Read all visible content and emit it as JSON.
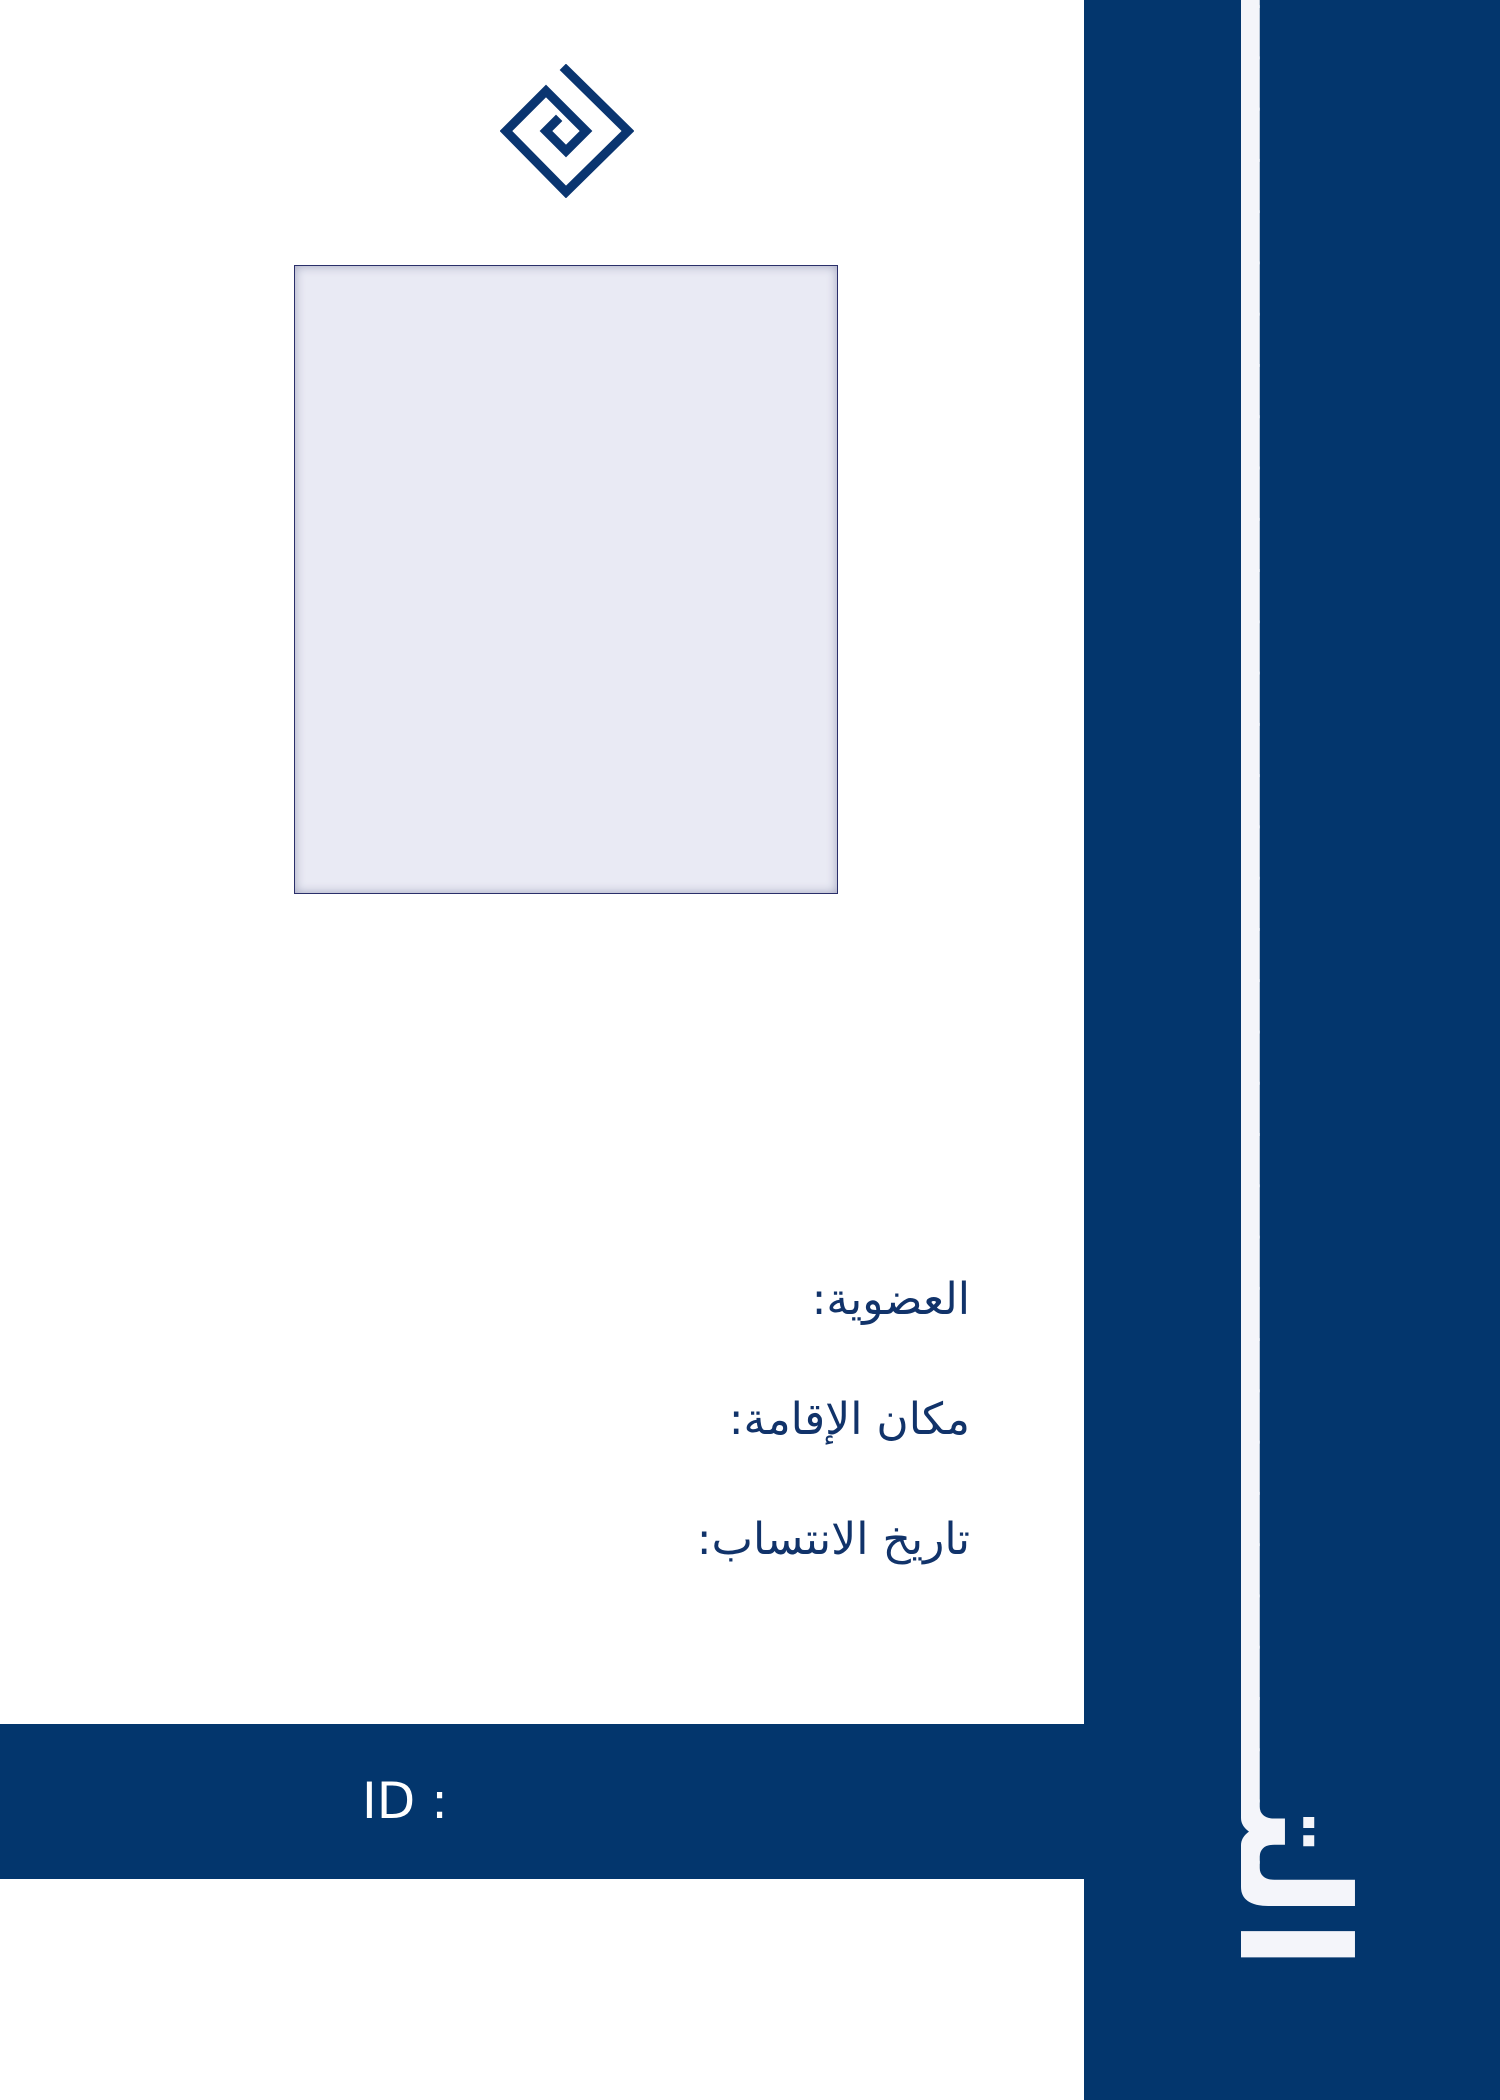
{
  "side_title": "التـــــــــــــــــــــــــــــــــــــــوكيـــــــــــــــــــــــــــــــــل",
  "logo": {
    "icon": "diamond-spiral-logo-icon",
    "color": "#0a3570"
  },
  "photo_placeholder": {
    "fill": "#e9eaf4",
    "border": "#2a2f6a"
  },
  "fields": [
    {
      "label": "العضوية:"
    },
    {
      "label": "مكان  الإقامة:"
    },
    {
      "label": "تاريخ  الانتساب:"
    }
  ],
  "id_bar": {
    "label": "ID :"
  },
  "colors": {
    "navy": "#03366d",
    "text_navy": "#11336a",
    "white": "#ffffff"
  }
}
